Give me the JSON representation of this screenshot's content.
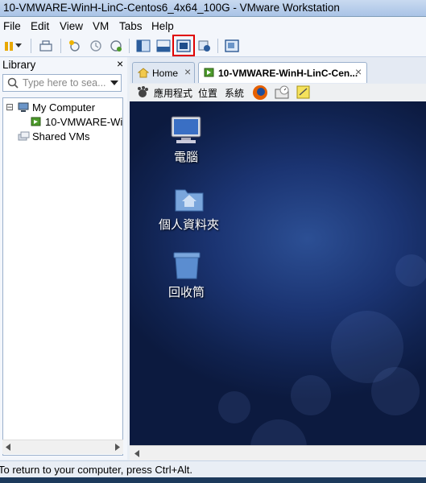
{
  "window": {
    "title": "10-VMWARE-WinH-LinC-Centos6_4x64_100G - VMware Workstation"
  },
  "menu": {
    "items": [
      "File",
      "Edit",
      "View",
      "VM",
      "Tabs",
      "Help"
    ]
  },
  "toolbar": {
    "icons": [
      "pause-icon",
      "dropdown-arrow-icon",
      "send-ctrl-alt-del-icon",
      "snapshot-icon",
      "revert-snapshot-icon",
      "snapshot-manager-icon",
      "library-view-icon",
      "console-view-icon",
      "full-screen-icon",
      "unity-icon",
      "thumbnail-icon"
    ],
    "highlighted": "full-screen-icon",
    "highlight_color": "#e00000"
  },
  "library": {
    "title": "Library",
    "close": "×",
    "search_placeholder": "Type here to sea...",
    "tree": {
      "expander": "⊟",
      "my_computer": "My Computer",
      "vm": "10-VMWARE-Wi",
      "shared": "Shared VMs"
    }
  },
  "tabs": {
    "home": "Home",
    "vm": "10-VMWARE-WinH-LinC-Cen...",
    "close": "×"
  },
  "guest_panel": {
    "applications": "應用程式",
    "places": "位置",
    "system": "系統"
  },
  "desktop_icons": {
    "computer": "電腦",
    "home": "個人資料夾",
    "trash": "回收筒"
  },
  "status": {
    "message": "To return to your computer, press Ctrl+Alt."
  },
  "colors": {
    "desktop_bg": "#1b3472",
    "accent": "#3a6fc4"
  }
}
